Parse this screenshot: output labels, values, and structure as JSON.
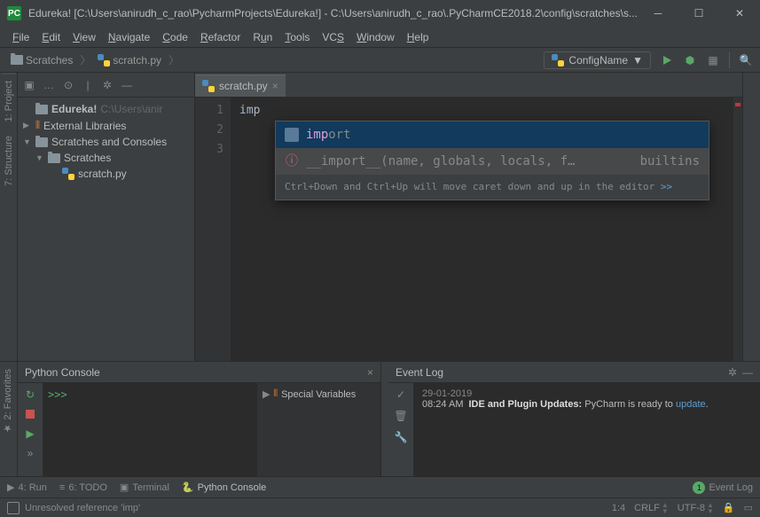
{
  "titlebar": {
    "app_icon": "PC",
    "text": "Edureka! [C:\\Users\\anirudh_c_rao\\PycharmProjects\\Edureka!] - C:\\Users\\anirudh_c_rao\\.PyCharmCE2018.2\\config\\scratches\\s..."
  },
  "menus": [
    "File",
    "Edit",
    "View",
    "Navigate",
    "Code",
    "Refactor",
    "Run",
    "Tools",
    "VCS",
    "Window",
    "Help"
  ],
  "breadcrumbs": {
    "items": [
      "Scratches",
      "scratch.py"
    ]
  },
  "runconfig": {
    "label": "ConfigName"
  },
  "project_tree": {
    "root": {
      "name": "Edureka!",
      "path": "C:\\Users\\anir"
    },
    "external_libs": "External Libraries",
    "scratches_consoles": "Scratches and Consoles",
    "scratches": "Scratches",
    "scratch_file": "scratch.py"
  },
  "editor": {
    "tab": "scratch.py",
    "lines": [
      "1",
      "2",
      "3"
    ],
    "code_line1": "imp"
  },
  "completion": {
    "item1_prefix": "imp",
    "item1_rest": "ort",
    "item2_text": "__import__(name, globals, locals, f…",
    "item2_right": "builtins",
    "hint": "Ctrl+Down and Ctrl+Up will move caret down and up in the editor ",
    "hint_link": ">>"
  },
  "console": {
    "title": "Python Console",
    "prompt": ">>>",
    "vars_title": "Special Variables"
  },
  "eventlog": {
    "title": "Event Log",
    "date": "29-01-2019",
    "time": "08:24 AM",
    "msg_bold": "IDE and Plugin Updates:",
    "msg_rest": " PyCharm is ready to ",
    "msg_link": "update"
  },
  "bottom_toolbar": {
    "run": "4: Run",
    "todo": "6: TODO",
    "terminal": "Terminal",
    "console": "Python Console",
    "eventlog": "Event Log",
    "badge": "1"
  },
  "statusbar": {
    "msg": "Unresolved reference 'imp'",
    "pos": "1:4",
    "sep": "CRLF",
    "enc": "UTF-8"
  }
}
